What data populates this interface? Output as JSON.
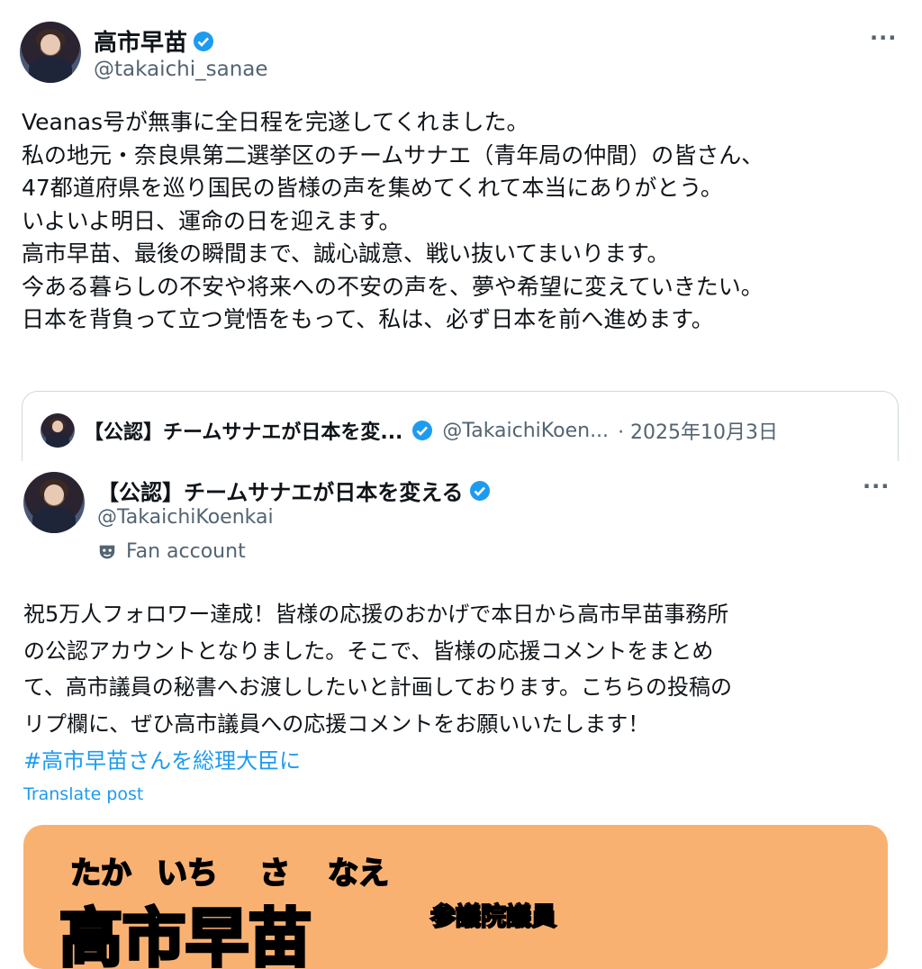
{
  "tweet": {
    "display_name": "高市早苗",
    "handle": "@takaichi_sanae",
    "more": "···",
    "text": "Veanas号が無事に全日程を完遂してくれました。\n私の地元・奈良県第二選挙区のチームサナエ（青年局の仲間）の皆さん、\n47都道府県を巡り国民の皆様の声を集めてくれて本当にありがとう。\nいよいよ明日、運命の日を迎えます。\n高市早苗、最後の瞬間まで、誠心誠意、戦い抜いてまいります。\n今ある暮らしの不安や将来への不安の声を、夢や希望に変えていきたい。\n日本を背負って立つ覚悟をもって、私は、必ず日本を前へ進めます。",
    "quote": {
      "display_name": "【公認】チームサナエが日本を変...",
      "handle": "@TakaichiKoen...",
      "date": "· 2025年10月3日"
    }
  },
  "retweet": {
    "display_name": "【公認】チームサナエが日本を変える",
    "handle": "@TakaichiKoenkai",
    "more": "···",
    "fan_label": "Fan account",
    "text": "祝5万人フォロワー達成！皆様の応援のおかげで本日から高市早苗事務所\nの公認アカウントとなりました。そこで、皆様の応援コメントをまとめ\nて、高市議員の秘書へお渡ししたいと計画しております。こちらの投稿の\nリプ欄に、ぜひ高市議員への応援コメントをお願いいたします！",
    "hashtag": "#高市早苗さんを総理大臣に",
    "translate": "Translate post",
    "media": {
      "ruby": [
        "たか",
        "いち",
        "さ",
        "なえ"
      ],
      "title": "参議院議員",
      "name": "高市早苗"
    }
  },
  "colors": {
    "verified": "#1d9bf0",
    "link": "#1d9bf0",
    "secondary": "#536471",
    "media_bg": "#f9b172"
  },
  "icons": [
    "verified-badge-icon",
    "more-icon",
    "fan-account-mask-icon"
  ]
}
